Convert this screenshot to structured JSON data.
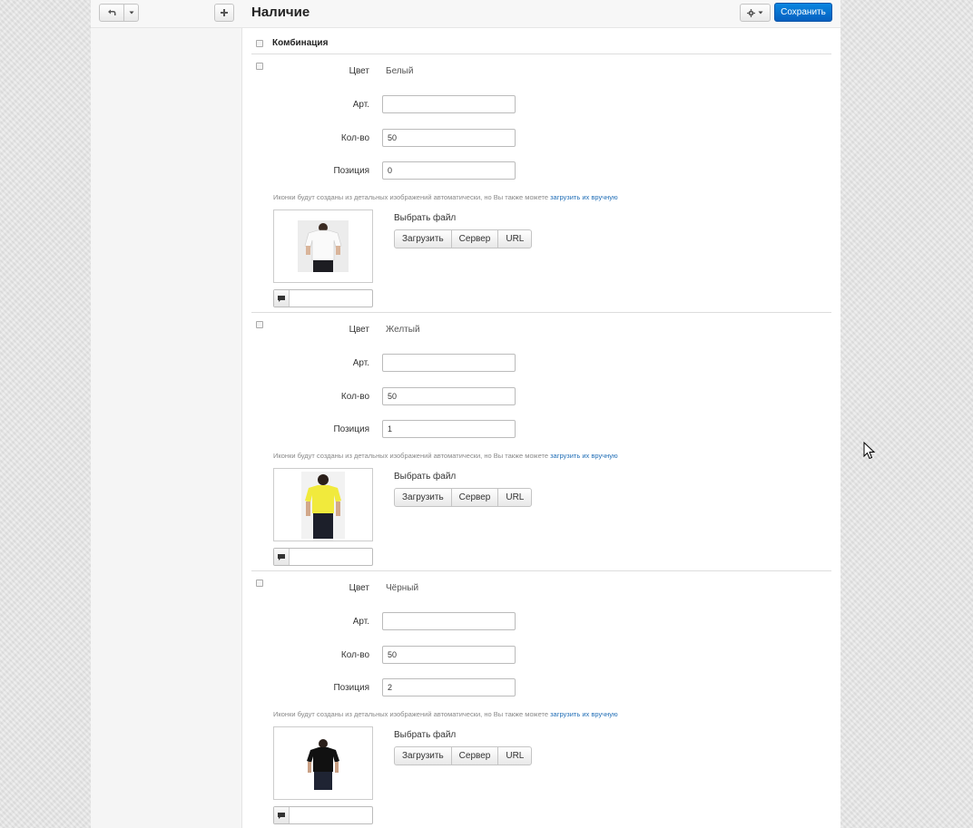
{
  "header": {
    "title": "Наличие",
    "save_label": "Сохранить",
    "accent_color": "#0a6fd0"
  },
  "list_header": {
    "label": "Комбинация"
  },
  "labels": {
    "color": "Цвет",
    "sku": "Арт.",
    "qty": "Кол-во",
    "position": "Позиция",
    "note": "Иконки будут созданы из детальных изображений автоматически, но Вы также можете",
    "note_link": "загрузить их вручную",
    "choose_file": "Выбрать файл",
    "upload": "Загрузить",
    "server": "Сервер",
    "url": "URL"
  },
  "combinations": [
    {
      "color": "Белый",
      "sku": "",
      "qty": "50",
      "position": "0",
      "image": "white-tshirt-image",
      "alt": ""
    },
    {
      "color": "Желтый",
      "sku": "",
      "qty": "50",
      "position": "1",
      "image": "yellow-tshirt-image",
      "alt": ""
    },
    {
      "color": "Чёрный",
      "sku": "",
      "qty": "50",
      "position": "2",
      "image": "black-tshirt-image",
      "alt": ""
    }
  ]
}
